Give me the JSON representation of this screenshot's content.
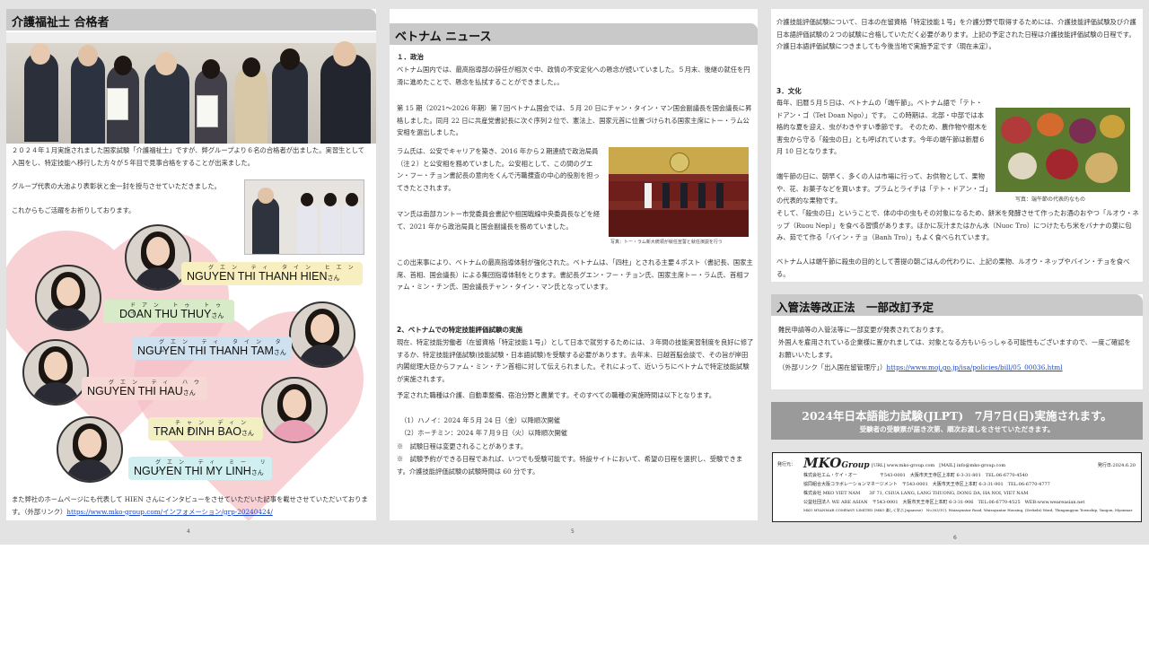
{
  "page4": {
    "title": "介護福祉士 合格者",
    "paragraph1": "２０２４年１月実施されました国家試験「介護福祉士」ですが、弊グループより６名の合格者が出ました。実習生として入国をし、特定技能へ移行した方々が５年目で見事合格をすることが出来ました。",
    "paragraph2": "グループ代表の大池より表彰状と金一封を授与させていただきました。",
    "paragraph3": "これからもご活躍をお祈りしております。",
    "names": [
      {
        "ruby": "グエン ティ タイン ヒエン",
        "name": "NGUYEN THI THANH HIEN",
        "san": "さん"
      },
      {
        "ruby": "ドアン トゥ トゥイ",
        "name": "DOAN THU THUY",
        "san": "さん"
      },
      {
        "ruby": "グエン ティ タイン タム",
        "name": "NGUYEN THI THANH TAM",
        "san": "さん"
      },
      {
        "ruby": "グエン ティ ハウ",
        "name": "NGUYEN THI HAU",
        "san": "さん"
      },
      {
        "ruby": "チャン ディン バオ",
        "name": "TRAN DINH BAO",
        "san": "さん"
      },
      {
        "ruby": "グエン ティ ミー リン",
        "name": "NGUYEN THI MY LINH",
        "san": "さん"
      }
    ],
    "footer_text": "また弊社のホームページにも代表して HIEN さんにインタビューをさせていただいた記事を載せさせていただいております。（外部リンク）",
    "footer_link": "https://www.mko-group.com/インフォメーション/grp-20240424/",
    "page_number": "4"
  },
  "page5": {
    "title": "ベトナム ニュース",
    "s1_heading": "１．政治",
    "s1_p1": "ベトナム国内では、最高指導部の辞任が相次ぐ中、政情の不安定化への懸念が続いていました。５月末、後継の就任を円滑に進めたことで、懸念を払拭することができました。。",
    "s1_p2": "第 15 期（2021～2026 年期）第７回ベトナム国会では、５月 20 日にチャン・タイン・マン国会副議長を国会議長に昇格しました。同月 22 日に共産党書記長に次ぐ序列２位で、憲法上、国家元首に位置づけられる国家主席にトー・ラム公安相を選出しました。",
    "s1_p3": "ラム氏は、公安でキャリアを築き、2016 年から２期連続で政治局員（注２）と公安相を務めていました。公安相として、この間のグエン・フー・チョン書記長の意向をくんで汚職捜査の中心的役割を担ってきたとされます。",
    "s1_p4": "マン氏は南部カントー市党委員会書記や祖国戦線中央委員長などを経て、2021 年から政治局員と国会副議長を務めていました。",
    "photo_caption": "写真：トー・ラム新大統領が就任宣誓と就任演説を行う",
    "s1_p5": "この出来事により、ベトナムの最高指導体制が強化された。ベトナムは、「四柱」とされる主要４ポスト（書記長、国家主席、首相、国会議長）による集団指導体制をとります。書記長グエン・フー・チョン氏、国家主席トー・ラム氏、首相ファム・ミン・チン氏、国会議長チャン・タイン・マン氏となっています。",
    "s2_heading": "2、ベトナムでの特定技能評価試験の実施",
    "s2_p1": "現在、特定技能労働者（在留資格「特定技能１号」）として日本で就労するためには、３年間の技能実習制度を良好に修了するか、特定技能評価試験(技能試験・日本語試験)を受験する必要があります。去年末、日越首脳会談で、その旨が岸田内閣総理大臣からファム・ミン・チン首相に対して伝えられました。それによって、近いうちにベトナムで特定技能試験が実施されます。",
    "s2_p2": "予定された職種は介護、自動車整備、宿泊分野と農業です。そのすべての職種の実施時間は以下となります。",
    "s2_item1": "（1）ハノイ：2024 年５月 24 日（金）以降順次開催",
    "s2_item2": "（2）ホーチミン：2024 年７月９日（火）以降順次開催",
    "s2_note1": "※　試験日程は変更されることがあります。",
    "s2_note2": "※　試験予約ができる日程であれば、いつでも受験可能です。特設サイトにおいて、希望の日程を選択し、受験できます。介護技能評価試験の試験時間は 60 分です。",
    "page_number": "5"
  },
  "page6": {
    "top_text": "介護技能評価試験について、日本の在留資格「特定技能１号」を介護分野で取得するためには、介護技能評価試験及び介護日本語評価試験の２つの試験に合格していただく必要があります。上記の予定された日程は介護技能評価試験の日程です。介護日本語評価試験につきましても今後当地で実施予定です（現在未定）。",
    "s3_heading": "3．文化",
    "s3_p1": "毎年、旧暦５月５日は、ベトナムの「端午節」。ベトナム語で「テト・ドアン・ゴ（Tet Doan Ngo）」です。 この時期は、北部・中部では本格的な夏を迎え、虫がわきやすい季節です。 そのため、農作物や樹木を害虫から守る「殺虫の日」とも呼ばれています。今年の端午節は新暦６月 10 日となります。",
    "s3_p2": "端午節の日に、朝早く、多くの人は市場に行って、お供物として、果物や、花、お菓子などを買います。プラムとライチは「テト・ドアン・ゴ」の代表的な果物です。",
    "photo_caption": "写真：端午節の代表的なもの",
    "s3_p3": "そして、「殺虫の日」ということで、体の中の虫もその対象になるため、餅米を発酵させて作ったお酒のおやつ「ルオウ・ネップ（Ruou Nep）」を食べる習慣があります。ほかに灰汁またはかん水（Nuoc Tro）につけたもち米をバナナの葉に包み、茹でて作る「バイン・チョ（Banh Tro）」もよく食べられています。",
    "s3_p4": "ベトナム人は端午節に殺虫の目的として菩提の朝ごはんの代わりに、上記の果物、ルオウ・ネップやバイン・チョを食べる。",
    "immig_title": "入管法等改正法　一部改訂予定",
    "immig_p1": "難民申請等の入管法等に一部変更が発表されております。",
    "immig_p2": "外国人を雇用されている企業様に置かれましては、対象となる方もいらっしゃる可能性もございますので、一度ご確認をお願いいたします。",
    "immig_link_label": "（外部リンク「出入国在留管理庁」）",
    "immig_link": "https://www.moj.go.jp/isa/policies/bill/05_00036.html",
    "jlpt_line1": "2024年日本語能力試験(JLPT)　7月7日(日)実施されます。",
    "jlpt_line2": "受験者の受験票が届き次第、順次お渡しをさせていただきます。",
    "publisher_label": "発行元：",
    "brand_mko": "MKO",
    "brand_group": "Group",
    "url_line": "[URL] www.mko-group.com　[MAIL] info@mko-group.com",
    "issue_date": "発行日:2024.6.20",
    "company1": "株式会社エム・ケイ・オー　　　　　〒543-0001　大阪市天王寺区上本町 6-3-31-801　TEL:06-6770-4540",
    "company2": "協同組合大阪コラボレーションマネージメント　〒543-0001　大阪市天王寺区上本町 6-3-31-901　TEL:06-6770-4777",
    "company3": "株式会社 MKO VIET NAM　　3F 71, CHUA LANG, LANG THUONG, DONG DA, HA NOI, VIET NAM",
    "company4": "公益社団法人 WE ARE ASIAN　〒543-0001　大阪市天王寺区上本町 6-3-31-906　TEL:06-6770-4525　WEB:www.weareasian.net",
    "company5": "MKO MYANMAR COMPANY LIMITED (MKO 楽しく学ぶ Japanese)　No.(63/1C), Waizayantar Road, Waizayantar Housing, (Zerkebi) Ward, Thingangyun Township, Yangon, Myanmar",
    "page_number": "6"
  },
  "colors": {
    "banner": "#c9c9c9",
    "jlpt_banner": "#9a9a9a",
    "link": "#1a47c8",
    "heart": "#f6c2c8"
  }
}
